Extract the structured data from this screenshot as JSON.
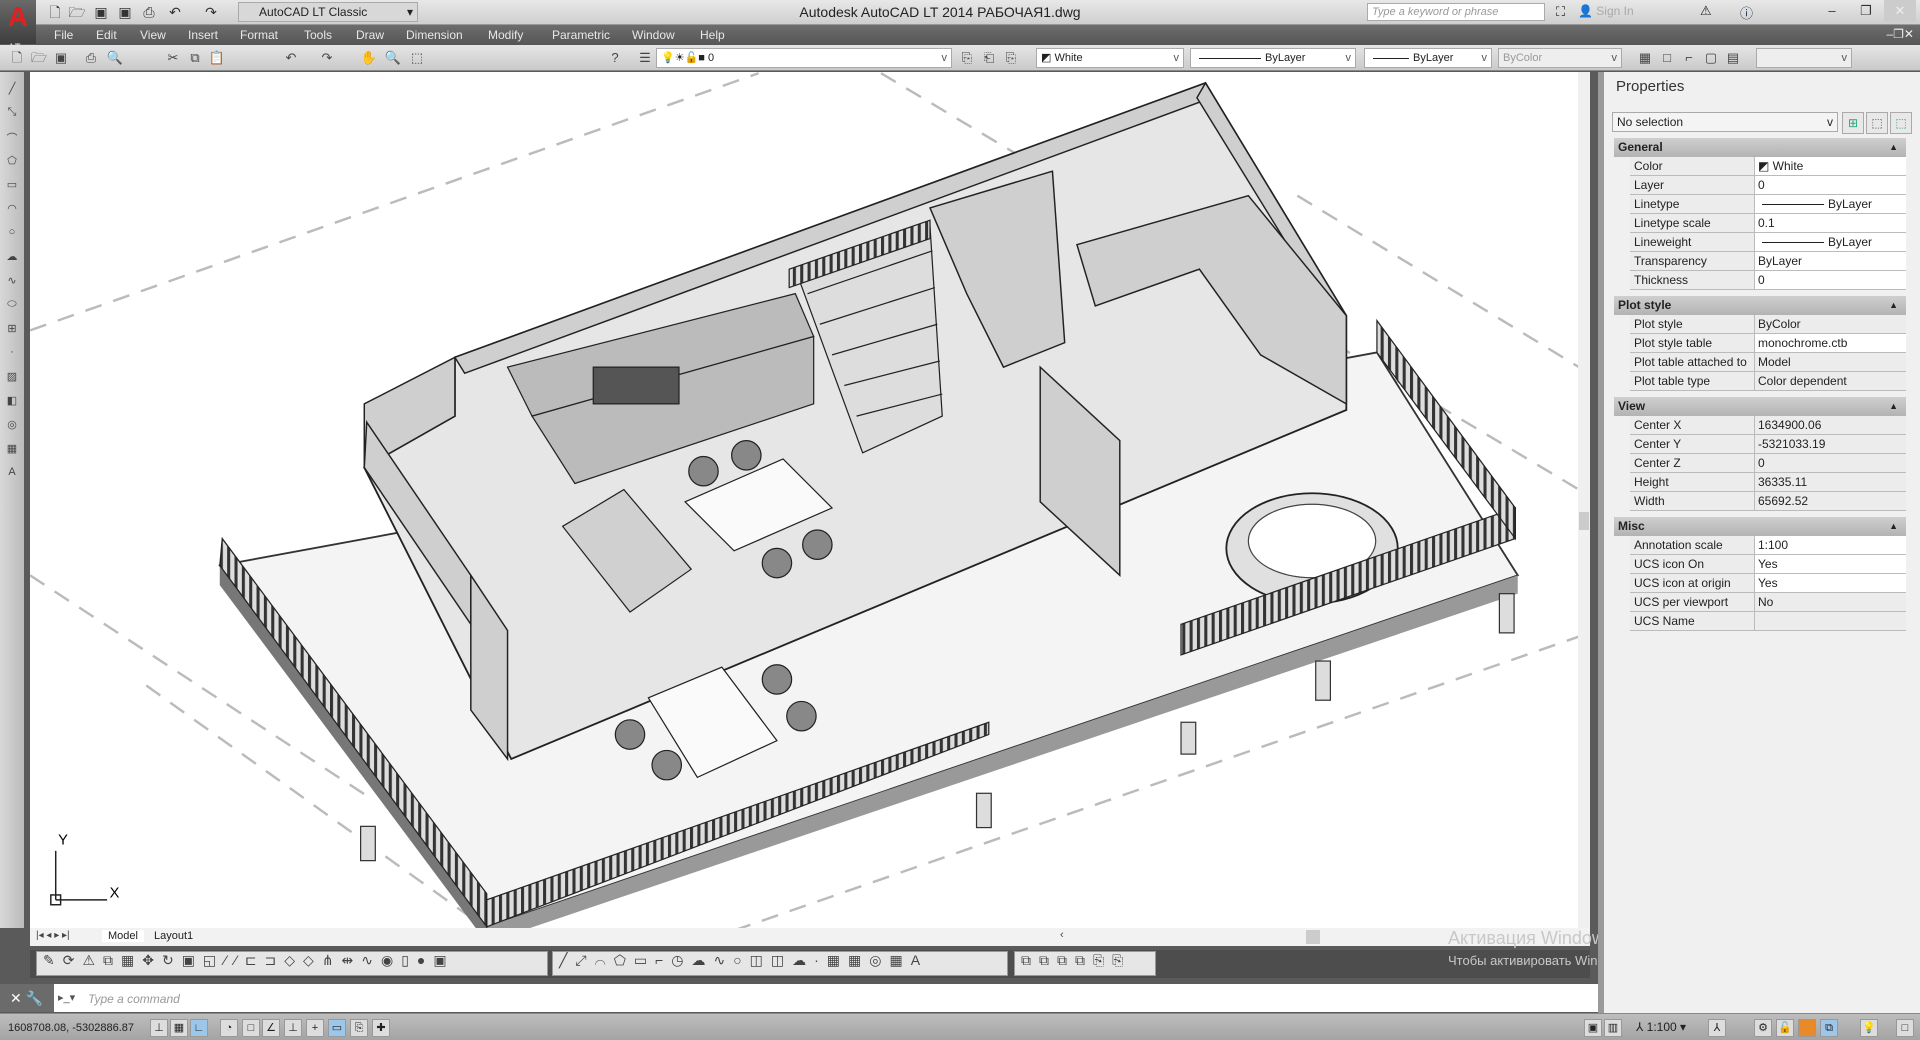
{
  "app": {
    "title": "Autodesk AutoCAD LT 2014    РАБОЧАЯ1.dwg",
    "logo": "A",
    "logo_sub": "LT",
    "workspace": "AutoCAD LT Classic",
    "search_placeholder": "Type a keyword or phrase",
    "sign_in": "Sign In"
  },
  "menu": [
    "File",
    "Edit",
    "View",
    "Insert",
    "Format",
    "Tools",
    "Draw",
    "Dimension",
    "Modify",
    "Parametric",
    "Window",
    "Help"
  ],
  "toolbar": {
    "layer": "0",
    "color": "White",
    "linetype": "ByLayer",
    "lineweight": "ByLayer",
    "plotstyle": "ByColor"
  },
  "tabs": [
    "Model",
    "Layout1"
  ],
  "ucs": {
    "x": "X",
    "y": "Y"
  },
  "command": {
    "placeholder": "Type a command"
  },
  "status": {
    "coords": "1608708.08, -5302886.87",
    "annotation_scale": "1:100"
  },
  "watermark": {
    "title": "Активация Windows",
    "text": "Чтобы активировать Windows, перейдите к параметрам компьютера."
  },
  "properties": {
    "title": "Properties",
    "selection": "No selection",
    "sections": [
      {
        "name": "General",
        "rows": [
          [
            "Color",
            "White"
          ],
          [
            "Layer",
            "0"
          ],
          [
            "Linetype",
            "ByLayer"
          ],
          [
            "Linetype scale",
            "0.1"
          ],
          [
            "Lineweight",
            "ByLayer"
          ],
          [
            "Transparency",
            "ByLayer"
          ],
          [
            "Thickness",
            "0"
          ]
        ]
      },
      {
        "name": "Plot style",
        "rows": [
          [
            "Plot style",
            "ByColor"
          ],
          [
            "Plot style table",
            "monochrome.ctb"
          ],
          [
            "Plot table attached to",
            "Model"
          ],
          [
            "Plot table type",
            "Color dependent"
          ]
        ]
      },
      {
        "name": "View",
        "rows": [
          [
            "Center X",
            "1634900.06"
          ],
          [
            "Center Y",
            "-5321033.19"
          ],
          [
            "Center Z",
            "0"
          ],
          [
            "Height",
            "36335.11"
          ],
          [
            "Width",
            "65692.52"
          ]
        ]
      },
      {
        "name": "Misc",
        "rows": [
          [
            "Annotation scale",
            "1:100"
          ],
          [
            "UCS icon On",
            "Yes"
          ],
          [
            "UCS icon at origin",
            "Yes"
          ],
          [
            "UCS per viewport",
            "No"
          ],
          [
            "UCS Name",
            ""
          ]
        ]
      }
    ]
  },
  "colors": {
    "accent": "#d22222",
    "menubar": "#5e5e5e",
    "canvas": "#ffffff"
  }
}
